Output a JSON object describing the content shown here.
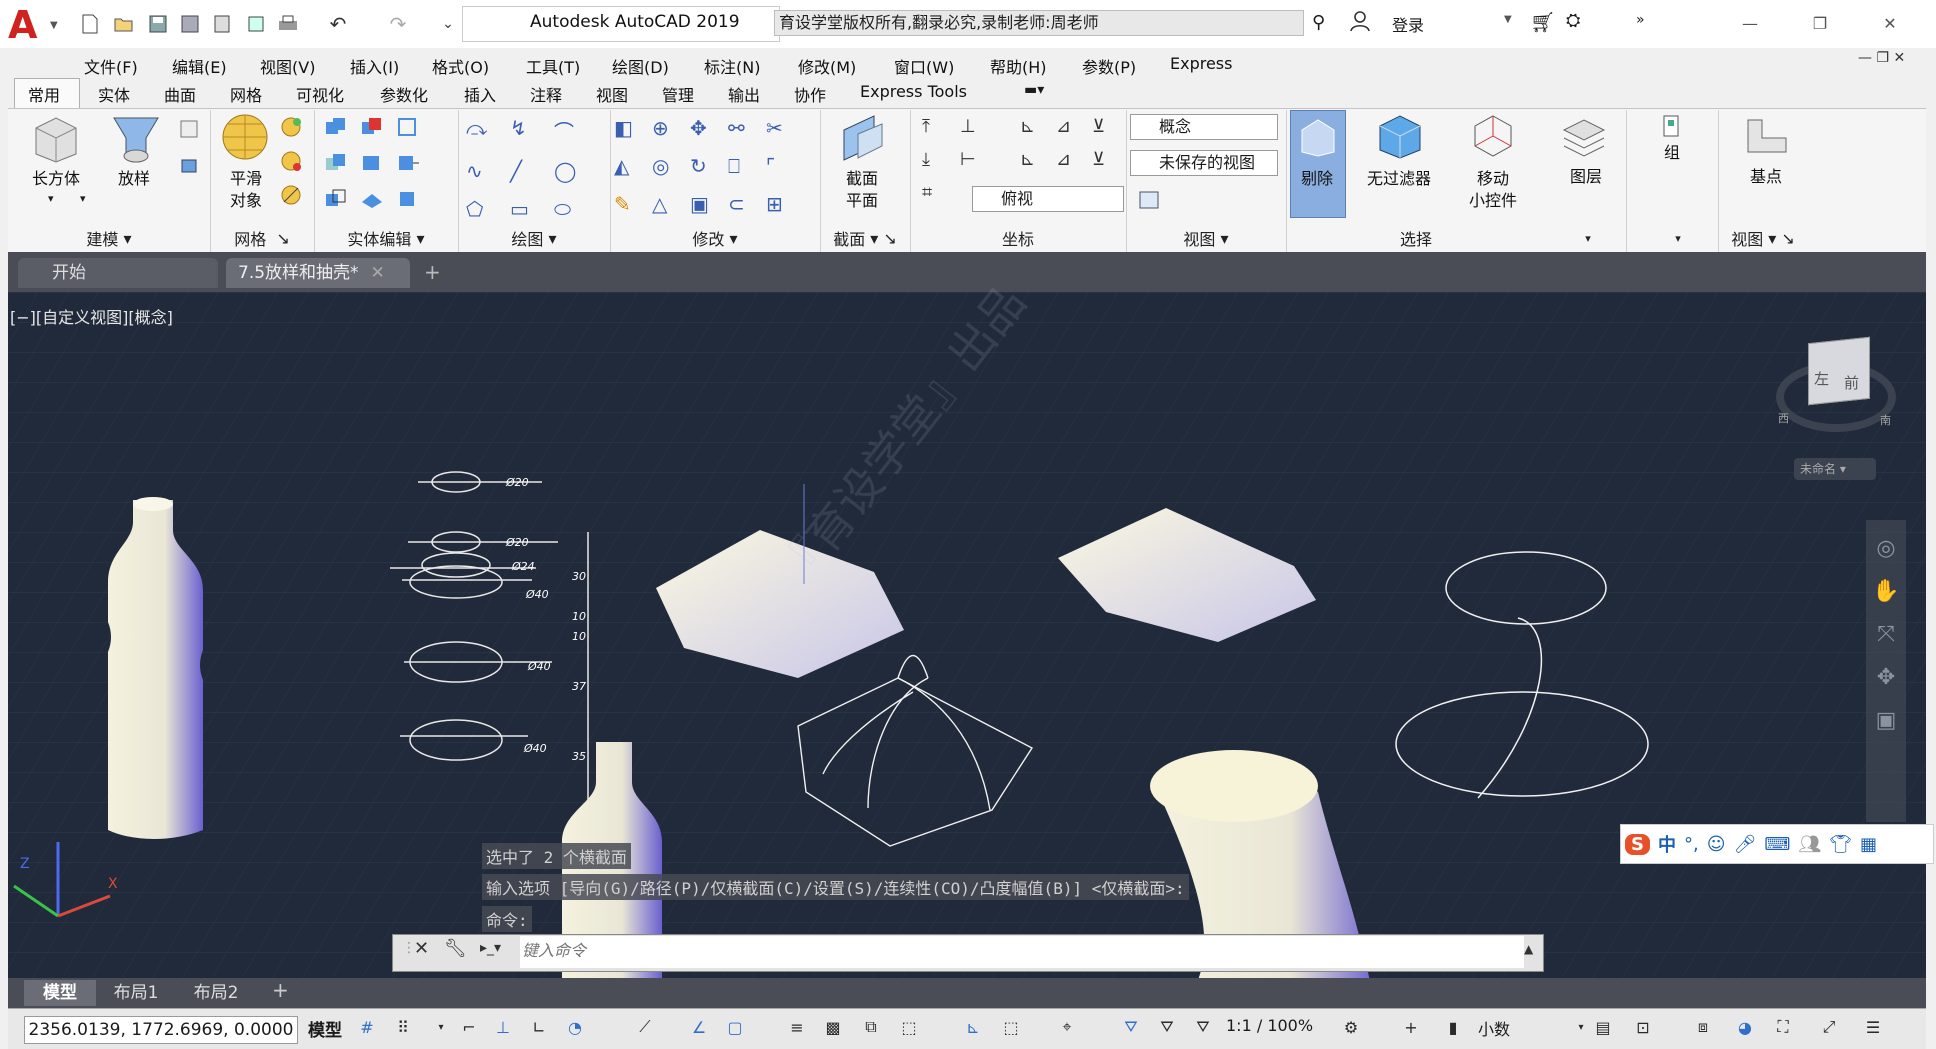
{
  "titlebar": {
    "app_title": "Autodesk AutoCAD 2019",
    "banner": "育设学堂版权所有,翻录必究,录制老师:周老师",
    "login": "登录"
  },
  "menus": [
    "文件(F)",
    "编辑(E)",
    "视图(V)",
    "插入(I)",
    "格式(O)",
    "工具(T)",
    "绘图(D)",
    "标注(N)",
    "修改(M)",
    "窗口(W)",
    "帮助(H)",
    "参数(P)",
    "Express"
  ],
  "ribbon_tabs": [
    "常用",
    "实体",
    "曲面",
    "网格",
    "可视化",
    "参数化",
    "插入",
    "注释",
    "视图",
    "管理",
    "输出",
    "协作",
    "Express Tools"
  ],
  "ribbon": {
    "box_label": "长方体",
    "loft_label": "放样",
    "smooth_label_1": "平滑",
    "smooth_label_2": "对象",
    "section_label_1": "截面",
    "section_label_2": "平面",
    "visual_style": "概念",
    "saved_view": "未保存的视图",
    "top_view": "俯视",
    "cull_label": "剔除",
    "nofilter_label": "无过滤器",
    "gizmo_label_1": "移动",
    "gizmo_label_2": "小控件",
    "layers_label": "图层",
    "group_label": "组",
    "base_label": "基点",
    "panels": [
      "建模",
      "网格",
      "实体编辑",
      "绘图",
      "修改",
      "截面",
      "坐标",
      "视图",
      "选择",
      "视图"
    ]
  },
  "file_tabs": [
    "开始",
    "7.5放样和抽壳*"
  ],
  "viewport": {
    "label": "[−][自定义视图][概念]",
    "watermark": "『育设学堂』出品",
    "viewcube_left": "左",
    "viewcube_front": "前",
    "viewcube_west": "西",
    "viewcube_south": "南",
    "wcs": "未命名",
    "dims": [
      "Ø20",
      "Ø20",
      "Ø24",
      "Ø40",
      "Ø40",
      "Ø40",
      "30",
      "10",
      "10",
      "37",
      "35"
    ]
  },
  "command": {
    "line1": "选中了 2 个横截面",
    "line2": "输入选项 [导向(G)/路径(P)/仅横截面(C)/设置(S)/连续性(CO)/凸度幅值(B)] <仅横截面>:",
    "line3": "命令:",
    "placeholder": "键入命令"
  },
  "layout_tabs": [
    "模型",
    "布局1",
    "布局2"
  ],
  "status": {
    "coords": "2356.0139, 1772.6969, 0.0000",
    "model": "模型",
    "scale": "1:1 / 100%",
    "units": "小数"
  },
  "ime": {
    "lang": "中"
  }
}
